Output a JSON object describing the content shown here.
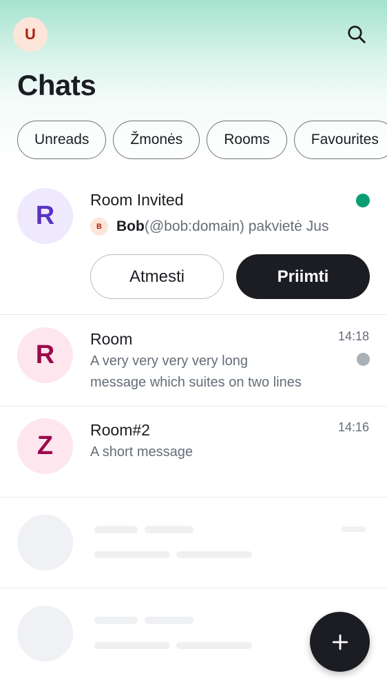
{
  "header": {
    "user_avatar_letter": "U",
    "title": "Chats"
  },
  "filters": [
    "Unreads",
    "Žmonės",
    "Rooms",
    "Favourites"
  ],
  "invite": {
    "avatar_letter": "R",
    "name": "Room Invited",
    "inviter_avatar_letter": "B",
    "inviter_name": "Bob",
    "inviter_text": "(@bob:domain) pakvietė Jus",
    "decline_label": "Atmesti",
    "accept_label": "Priimti"
  },
  "rooms": [
    {
      "avatar_letter": "R",
      "name": "Room",
      "time": "14:18",
      "message_line1": "A very very very very long",
      "message_line2": "message which suites on two lines"
    },
    {
      "avatar_letter": "Z",
      "name": "Room#2",
      "time": "14:16",
      "message_line1": "A short message"
    }
  ],
  "colors": {
    "accent_green": "#0b9d74",
    "unread_dot": "#aab0b7",
    "invite_avatar_bg": "#efe9fe",
    "invite_avatar_fg": "#5b33c4",
    "room_avatar_bg": "#fde6ee",
    "room_avatar_fg": "#9b0a4b"
  },
  "icons": {
    "search": "search-icon",
    "fab": "plus-icon"
  }
}
